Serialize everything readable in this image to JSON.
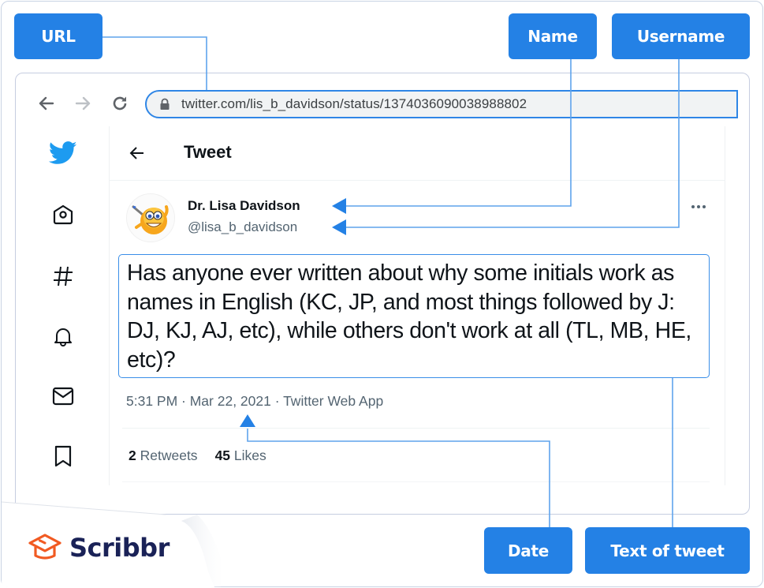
{
  "browser": {
    "url": "twitter.com/lis_b_davidson/status/1374036090038988802",
    "nav": {
      "back_icon": "arrow-left-icon",
      "forward_icon": "arrow-right-icon",
      "reload_icon": "reload-icon",
      "lock_icon": "lock-icon"
    }
  },
  "sidebar": {
    "items": [
      {
        "name": "twitter-logo",
        "icon": "bird-icon"
      },
      {
        "name": "home",
        "icon": "home-icon"
      },
      {
        "name": "explore",
        "icon": "hashtag-icon"
      },
      {
        "name": "notifications",
        "icon": "bell-icon"
      },
      {
        "name": "messages",
        "icon": "mail-icon"
      },
      {
        "name": "bookmarks",
        "icon": "bookmark-icon"
      }
    ]
  },
  "tweet": {
    "header_title": "Tweet",
    "display_name": "Dr. Lisa Davidson",
    "username": "@lisa_b_davidson",
    "text": "Has anyone ever written about why some initials work as names in English (KC, JP, and most things followed by J: DJ, KJ, AJ, etc), while others don't work at all (TL, MB, HE, etc)?",
    "meta": "5:31 PM · Mar 22, 2021 · Twitter Web App",
    "retweets_count": "2",
    "retweets_label": "Retweets",
    "likes_count": "45",
    "likes_label": "Likes"
  },
  "annotations": {
    "url": "URL",
    "name": "Name",
    "username": "Username",
    "date": "Date",
    "text": "Text of tweet"
  },
  "colors": {
    "annotation_blue": "#2481e5",
    "twitter_blue": "#1d9bf0",
    "brand_orange": "#f15a22",
    "brand_navy": "#1a2257"
  },
  "brand": {
    "name": "Scribbr"
  }
}
